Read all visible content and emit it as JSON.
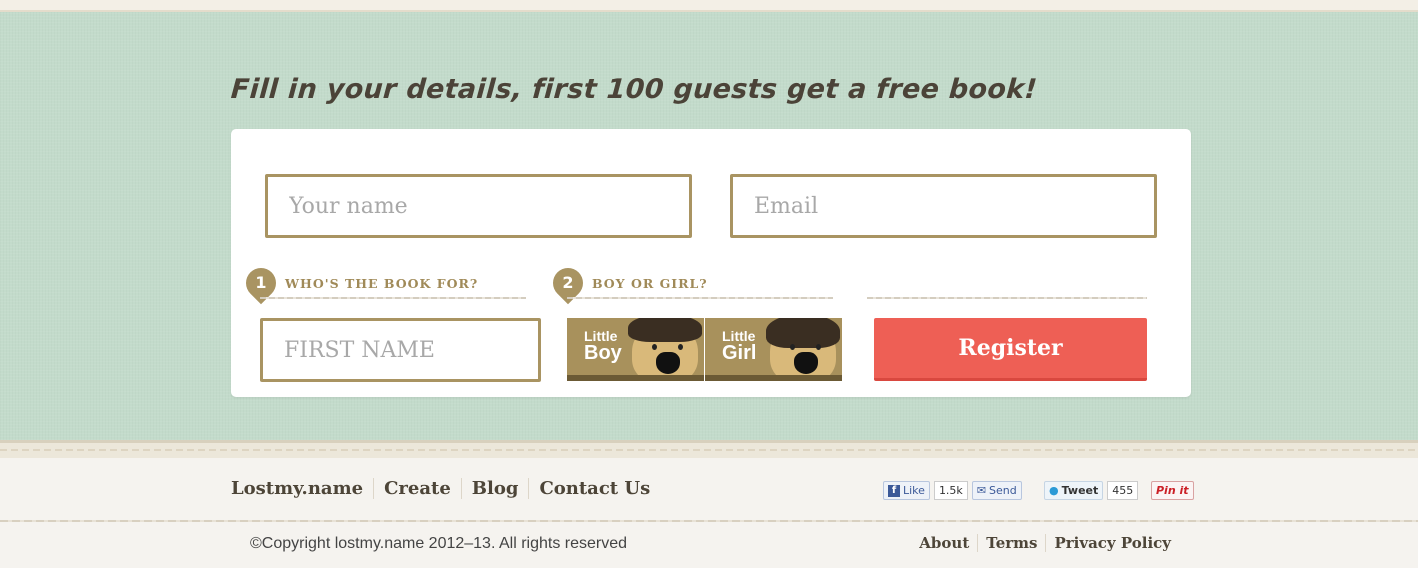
{
  "headline": "Fill in your details, first 100 guests get a free book!",
  "form": {
    "name_placeholder": "Your name",
    "email_placeholder": "Email",
    "first_name_placeholder": "FIRST NAME",
    "step1": {
      "number": "1",
      "label": "WHO'S THE BOOK FOR?"
    },
    "step2": {
      "number": "2",
      "label": "BOY OR GIRL?"
    },
    "boy": {
      "small": "Little",
      "big": "Boy"
    },
    "girl": {
      "small": "Little",
      "big": "Girl"
    },
    "register_label": "Register"
  },
  "footer": {
    "nav": [
      "Lostmy.name",
      "Create",
      "Blog",
      "Contact Us"
    ],
    "social": {
      "fb_like": "Like",
      "fb_like_count": "1.5k",
      "fb_send": "Send",
      "tweet": "Tweet",
      "tweet_count": "455",
      "pin": "Pin it"
    },
    "copyright": "©Copyright lostmy.name 2012–13. All rights reserved",
    "legal": [
      "About",
      "Terms",
      "Privacy Policy"
    ]
  },
  "colors": {
    "mint": "#c3dbcb",
    "gold": "#a99462",
    "register": "#ee5f55",
    "text_dark": "#4d4538"
  }
}
